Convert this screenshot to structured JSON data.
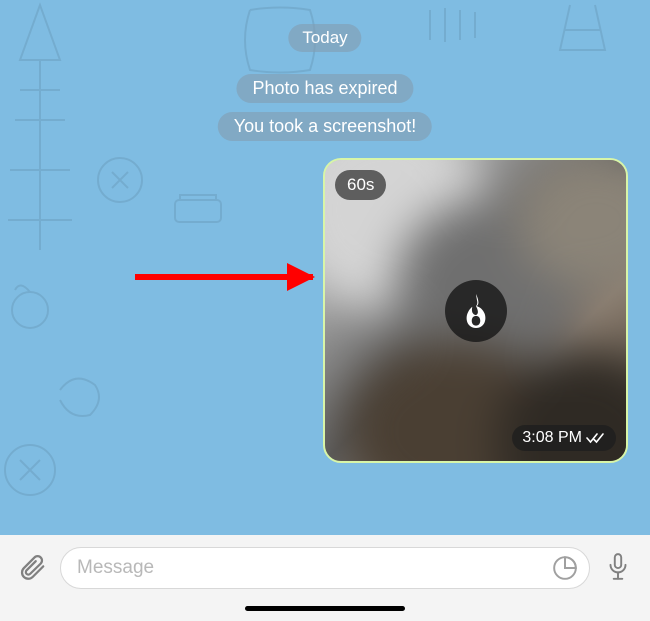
{
  "chat": {
    "date_label": "Today",
    "system_messages": [
      "Photo has expired",
      "You took a screenshot!"
    ],
    "photo": {
      "timer": "60s",
      "timestamp": "3:08 PM"
    }
  },
  "input": {
    "placeholder": "Message"
  }
}
